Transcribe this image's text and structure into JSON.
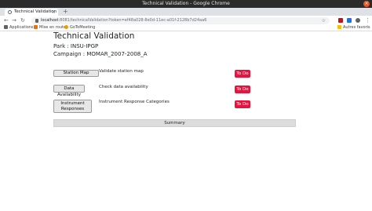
{
  "window": {
    "title": "Technical Validation - Google Chrome"
  },
  "browser": {
    "tab_title": "Technical Validation",
    "tab_close": "×",
    "new_tab": "+",
    "url_host": "localhost",
    "url_rest": ":8081/technicalValidation?token=ef48a028-8e0d-11ec-a01f-2128b7d24aa6",
    "bookmarks": [
      {
        "label": "Applications",
        "icon_color": "#5f6368"
      },
      {
        "label": "Mise en route",
        "icon_color": "#e8710a"
      },
      {
        "label": "GoToMeeting",
        "icon_color": "#f29900"
      }
    ],
    "other_bookmarks": "Autres favoris",
    "ext_colors": [
      "#c1121f",
      "#1a73e8",
      "#5f6368"
    ]
  },
  "page": {
    "title": "Technical Validation",
    "park_label": "Park : INSU-IPGP",
    "campaign_label": "Campaign : MOMAR_2007-2008_A",
    "rows": [
      {
        "button": "Station Map",
        "description": "Validate station map",
        "status": "To Do"
      },
      {
        "button": "Data Availability",
        "description": "Check data availability",
        "status": "To Do"
      },
      {
        "button_line1": "Instrument",
        "button_line2": "Responses",
        "description": "Instrument Response Categories",
        "status": "To Do"
      }
    ],
    "summary_label": "Summary"
  }
}
